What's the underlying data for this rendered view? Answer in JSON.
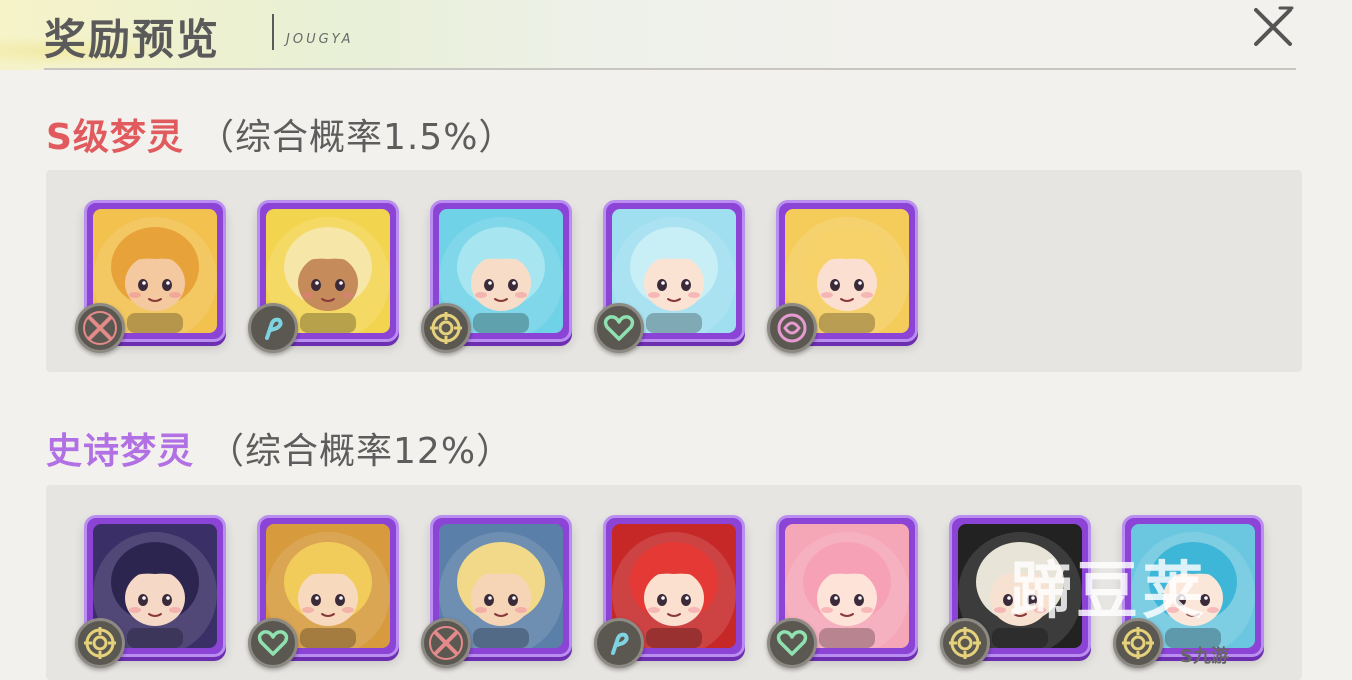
{
  "header": {
    "title": "奖励预览",
    "subtitle": "JOUGYA"
  },
  "sections": [
    {
      "name": "S级梦灵",
      "rate": "（综合概率1.5%）",
      "accent": "#e05a5e",
      "cards": [
        {
          "role": "warrior-icon",
          "bg": "#f2c14e",
          "hair": "#e8a23a",
          "skin": "#f4c9a0"
        },
        {
          "role": "mage-icon",
          "bg": "#f3d44f",
          "hair": "#f6e6a8",
          "skin": "#c58b5a"
        },
        {
          "role": "tank-icon",
          "bg": "#6fd2e6",
          "hair": "#a7e6f0",
          "skin": "#f7dcc7"
        },
        {
          "role": "healer-icon",
          "bg": "#9fdff0",
          "hair": "#c8eef6",
          "skin": "#fbe3d3"
        },
        {
          "role": "support-icon",
          "bg": "#f5cc5a",
          "hair": "#f7d16a",
          "skin": "#fbe0d2"
        }
      ]
    },
    {
      "name": "史诗梦灵",
      "rate": "（综合概率12%）",
      "accent": "#b170e4",
      "cards": [
        {
          "role": "tank-icon",
          "bg": "#3a2f66",
          "hair": "#2b2550",
          "skin": "#f6d8c6"
        },
        {
          "role": "healer-icon",
          "bg": "#d79a3d",
          "hair": "#f2cc5a",
          "skin": "#f7d9bd"
        },
        {
          "role": "warrior-icon",
          "bg": "#5a7fa8",
          "hair": "#f2d98a",
          "skin": "#f6d4b6"
        },
        {
          "role": "mage-icon",
          "bg": "#c62828",
          "hair": "#e53935",
          "skin": "#fbe0d0"
        },
        {
          "role": "healer-icon",
          "bg": "#f5a7b8",
          "hair": "#f7a1b6",
          "skin": "#fde3d8"
        },
        {
          "role": "tank-icon",
          "bg": "#222222",
          "hair": "#e9e4d8",
          "skin": "#f7e1d0"
        },
        {
          "role": "tank-icon",
          "bg": "#6bc7e0",
          "hair": "#3db6d8",
          "skin": "#fbe6da"
        }
      ]
    }
  ],
  "watermark": {
    "text": "蹄豆荚",
    "logo": "九游"
  }
}
